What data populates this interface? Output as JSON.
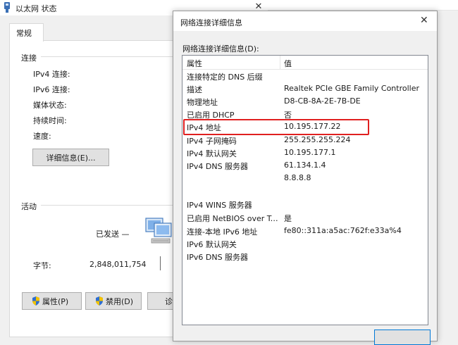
{
  "background_window": {
    "title": "以太网 状态",
    "close_glyph": "✕",
    "tab_label": "常规",
    "connection": {
      "group_label": "连接",
      "labels": [
        "IPv4 连接:",
        "IPv6 连接:",
        "媒体状态:",
        "持续时间:",
        "速度:"
      ],
      "details_button": "详细信息(E)..."
    },
    "activity": {
      "group_label": "活动",
      "sent_label": "已发送 —",
      "bytes_label": "字节:",
      "bytes_sent": "2,848,011,754"
    },
    "buttons": {
      "properties": "属性(P)",
      "disable": "禁用(D)",
      "diagnose_partial": "诊"
    }
  },
  "dialog": {
    "title": "网络连接详细信息",
    "close_glyph": "✕",
    "caption": "网络连接详细信息(D):",
    "columns": [
      "属性",
      "值"
    ],
    "rows": [
      {
        "property": "连接特定的 DNS 后缀",
        "value": ""
      },
      {
        "property": "描述",
        "value": "Realtek PCIe GBE Family Controller"
      },
      {
        "property": "物理地址",
        "value": "D8-CB-8A-2E-7B-DE"
      },
      {
        "property": "已启用 DHCP",
        "value": "否"
      },
      {
        "property": "IPv4 地址",
        "value": "10.195.177.22"
      },
      {
        "property": "IPv4 子网掩码",
        "value": "255.255.255.224"
      },
      {
        "property": "IPv4 默认网关",
        "value": "10.195.177.1"
      },
      {
        "property": "IPv4 DNS 服务器",
        "value": "61.134.1.4"
      },
      {
        "property": "",
        "value": "8.8.8.8"
      },
      {
        "property": "IPv4 WINS 服务器",
        "value": ""
      },
      {
        "property": "已启用 NetBIOS over Tc...",
        "value": "是"
      },
      {
        "property": "连接-本地 IPv6 地址",
        "value": "fe80::311a:a5ac:762f:e33a%4"
      },
      {
        "property": "IPv6 默认网关",
        "value": ""
      },
      {
        "property": "IPv6 DNS 服务器",
        "value": ""
      }
    ],
    "highlighted_row_index": 4,
    "highlight_color": "#e02020"
  }
}
